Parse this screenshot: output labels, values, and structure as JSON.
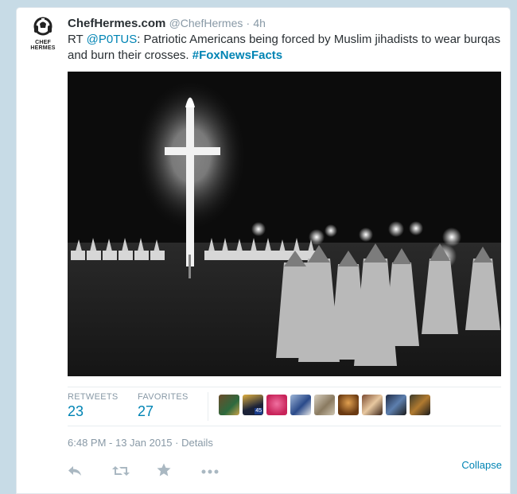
{
  "tweet": {
    "author_name": "ChefHermes.com",
    "author_handle": "@ChefHermes",
    "separator": "·",
    "relative_time": "4h",
    "avatar_text_line1": "CHEF",
    "avatar_text_line2": "HERMES",
    "text_prefix": "RT ",
    "mention": "@P0TUS",
    "text_body": ": Patriotic Americans being forced by Muslim jihadists to wear burqas and burn their crosses. ",
    "hashtag": "#FoxNewsFacts"
  },
  "stats": {
    "retweets_label": "RETWEETS",
    "retweets_count": "23",
    "favorites_label": "FAVORITES",
    "favorites_count": "27",
    "favoriter_badge": "45"
  },
  "meta": {
    "timestamp": "6:48 PM - 13 Jan 2015",
    "separator": "·",
    "details_label": "Details"
  },
  "actions": {
    "collapse_label": "Collapse",
    "reply_icon": "reply-icon",
    "retweet_icon": "retweet-icon",
    "favorite_icon": "star-icon",
    "more_icon": "more-icon"
  },
  "colors": {
    "link": "#0084b4",
    "muted": "#8899a6",
    "text": "#292f33",
    "page_bg": "#c7dbe6"
  }
}
